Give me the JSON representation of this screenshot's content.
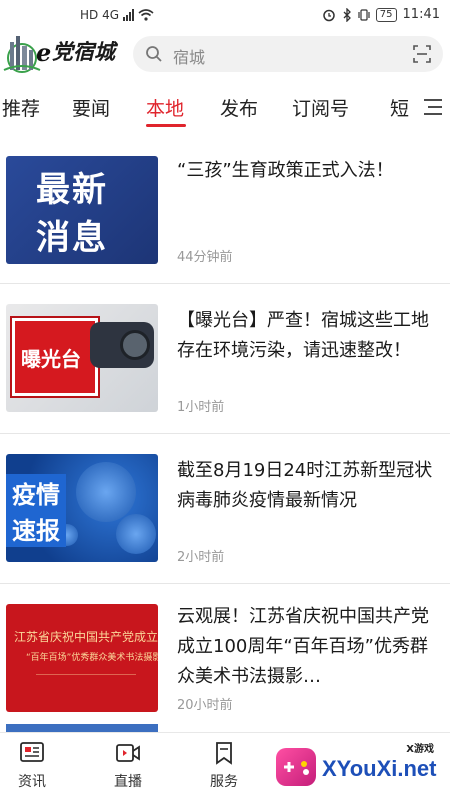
{
  "status_bar": {
    "network": "HD 4G",
    "battery": "75",
    "time": "11:41"
  },
  "header": {
    "brand": "党宿城",
    "search_placeholder": "宿城"
  },
  "tabs": [
    {
      "label": "推荐"
    },
    {
      "label": "要闻"
    },
    {
      "label": "本地",
      "active": true
    },
    {
      "label": "发布"
    },
    {
      "label": "订阅号"
    },
    {
      "label": "短"
    }
  ],
  "feed": [
    {
      "title": "“三孩”生育政策正式入法！",
      "time": "44分钟前",
      "thumb_text": [
        "最新",
        "消息"
      ]
    },
    {
      "title": "【曝光台】严查！宿城这些工地存在环境污染，请迅速整改！",
      "time": "1小时前",
      "thumb_text": [
        "曝光台"
      ]
    },
    {
      "title": "截至8月19日24时江苏新型冠状病毒肺炎疫情最新情况",
      "time": "2小时前",
      "thumb_text": [
        "疫情",
        "速报"
      ]
    },
    {
      "title": "云观展！江苏省庆祝中国共产党成立100周年“百年百场”优秀群众美术书法摄影…",
      "time": "20小时前",
      "thumb_text": [
        "江苏省庆祝中国共产党成立10",
        "“百年百场”优秀群众美术书法摄影"
      ]
    }
  ],
  "bottom_nav": [
    {
      "label": "资讯",
      "icon": "news-icon"
    },
    {
      "label": "直播",
      "icon": "video-icon"
    },
    {
      "label": "服务",
      "icon": "bookmark-icon"
    }
  ],
  "watermark": {
    "tag": "X游戏",
    "text": "XYouXi.net"
  },
  "colors": {
    "accent": "#e0242c",
    "text": "#1a1a1a",
    "muted": "#999999"
  }
}
